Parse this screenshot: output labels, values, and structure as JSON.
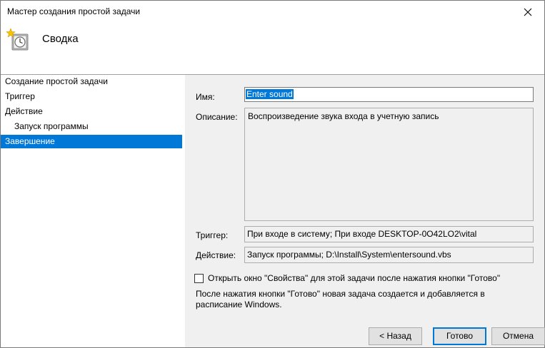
{
  "window": {
    "title": "Мастер создания простой задачи",
    "close_icon": "close-icon"
  },
  "header": {
    "title": "Сводка",
    "icon": "task-scheduler-clock-icon"
  },
  "nav": {
    "items": [
      {
        "label": "Создание простой задачи"
      },
      {
        "label": "Триггер"
      },
      {
        "label": "Действие"
      },
      {
        "label": "Запуск программы"
      },
      {
        "label": "Завершение",
        "selected": true
      }
    ]
  },
  "form": {
    "name_label": "Имя:",
    "name_value": "Enter sound",
    "description_label": "Описание:",
    "description_value": "Воспроизведение звука входа в учетную запись",
    "trigger_label": "Триггер:",
    "trigger_value": "При входе в систему; При входе DESKTOP-0O42LO2\\vital",
    "action_label": "Действие:",
    "action_value": "Запуск программы; D:\\Install\\System\\entersound.vbs",
    "checkbox_label": "Открыть окно \"Свойства\" для этой задачи после нажатия кнопки \"Готово\"",
    "checkbox_checked": false,
    "info_text": "После нажатия кнопки \"Готово\" новая задача создается и добавляется в расписание Windows."
  },
  "buttons": {
    "back": "< Назад",
    "finish": "Готово",
    "cancel": "Отмена"
  },
  "colors": {
    "accent": "#0078d7",
    "panel": "#f0f0f0"
  }
}
